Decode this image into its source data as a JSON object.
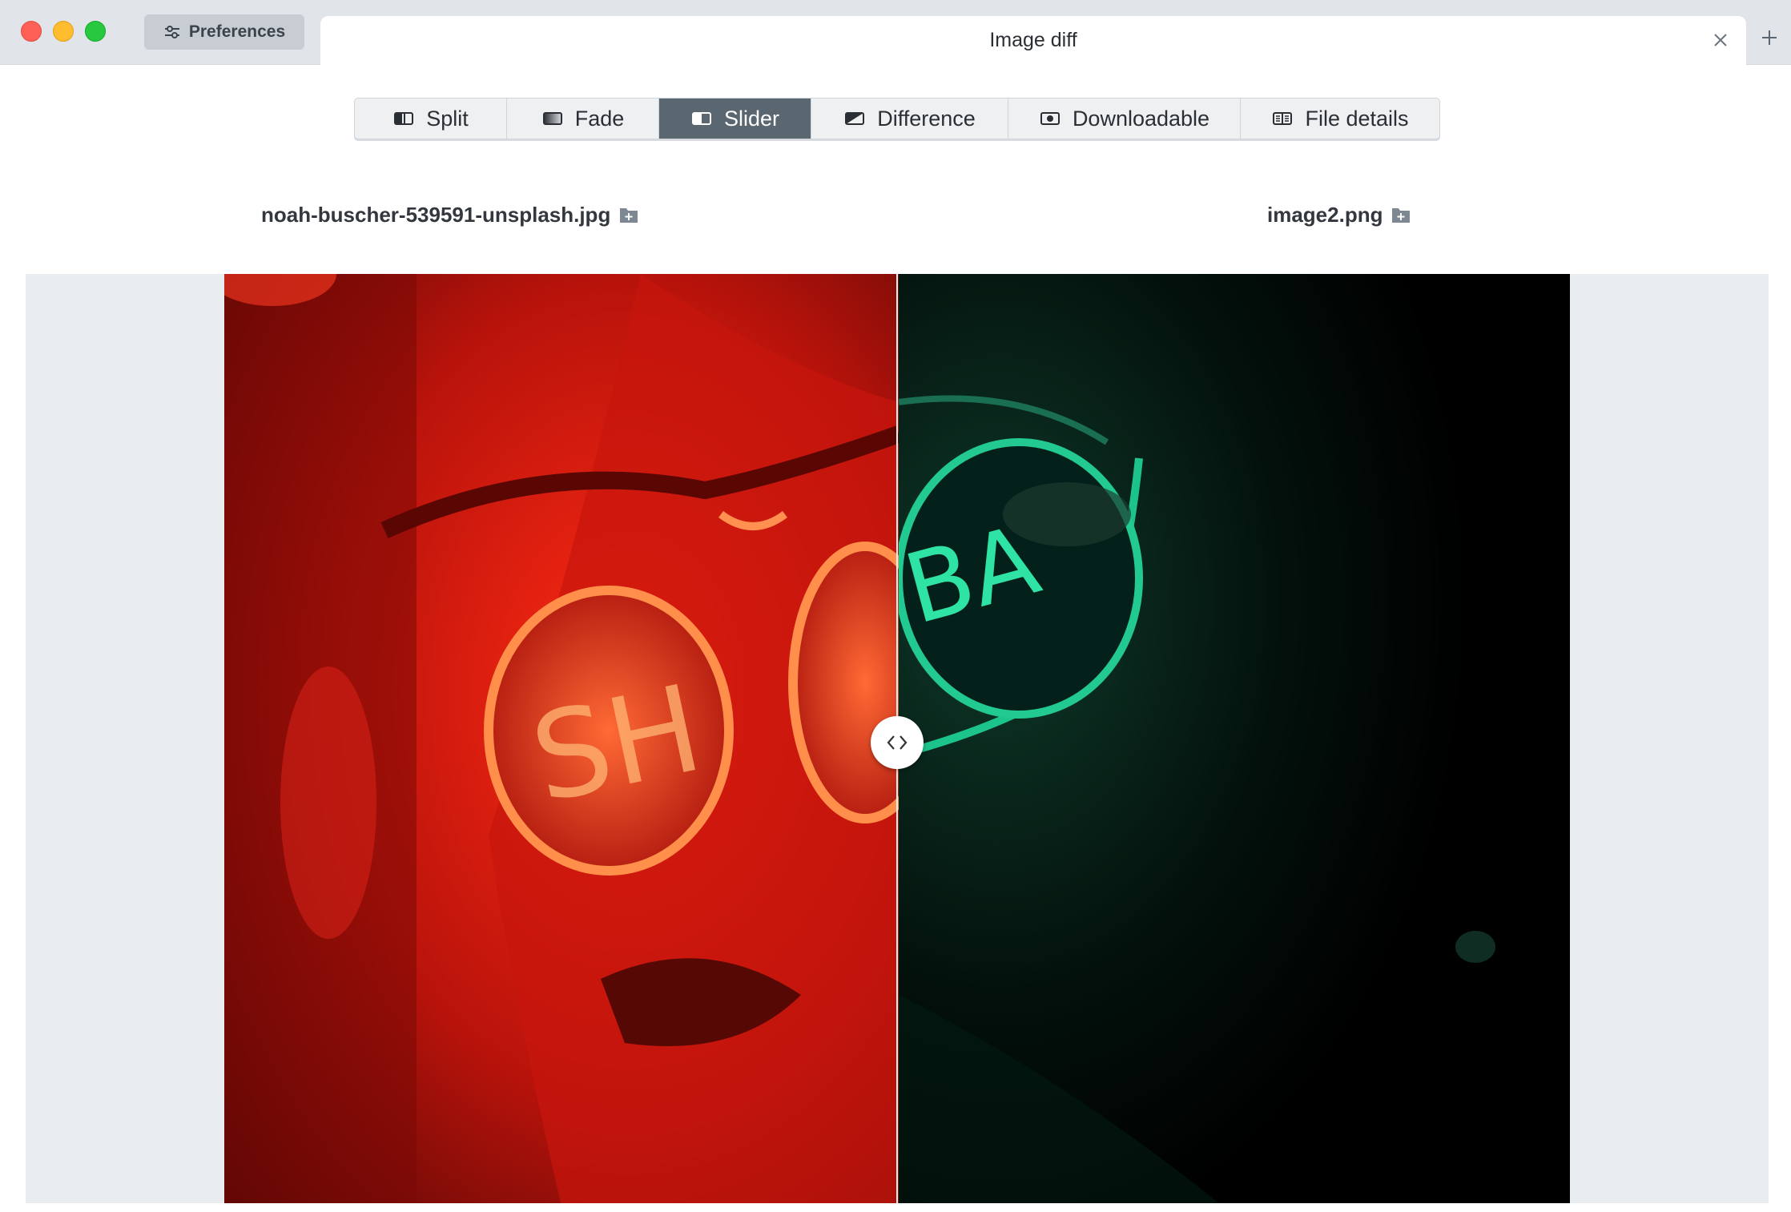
{
  "window": {
    "preferences_label": "Preferences",
    "tab_title": "Image diff"
  },
  "modes": [
    {
      "label": "Split",
      "icon": "split-icon"
    },
    {
      "label": "Fade",
      "icon": "fade-icon"
    },
    {
      "label": "Slider",
      "icon": "slider-icon",
      "active": true
    },
    {
      "label": "Difference",
      "icon": "difference-icon"
    },
    {
      "label": "Downloadable",
      "icon": "downloadable-icon"
    },
    {
      "label": "File details",
      "icon": "file-details-icon"
    }
  ],
  "files": {
    "left": "noah-buscher-539591-unsplash.jpg",
    "right": "image2.png"
  },
  "colors": {
    "active_mode_bg": "#5b6770",
    "left_image_tone": "#d21710",
    "right_image_tone": "#1dbf8a"
  },
  "slider": {
    "position": 0.5
  }
}
